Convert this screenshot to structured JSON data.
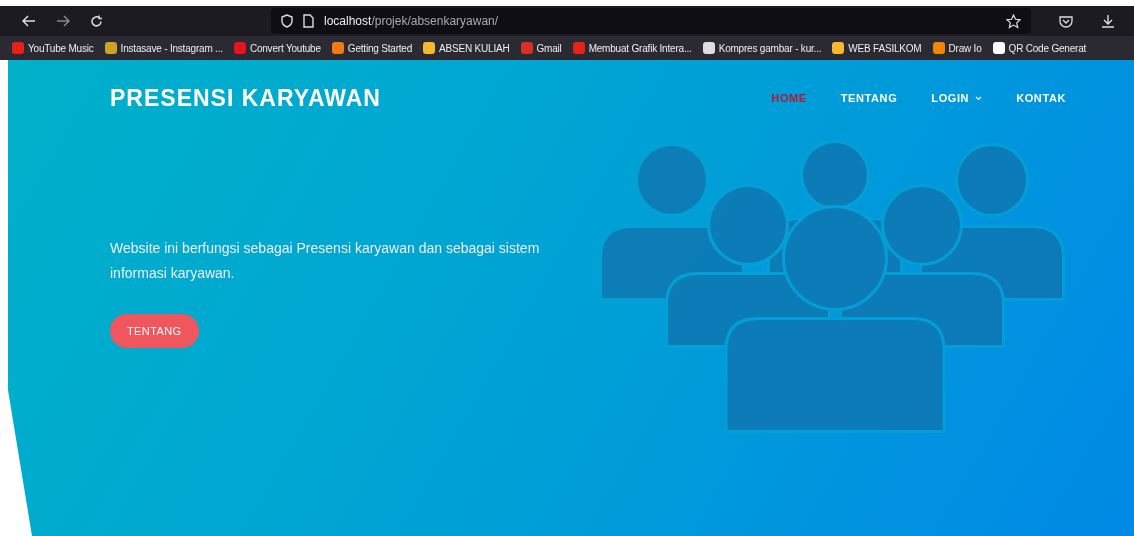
{
  "browser": {
    "url_host": "localhost",
    "url_path": "/projek/absenkaryawan/",
    "bookmarks": [
      {
        "label": "YouTube Music",
        "color": "#e62117"
      },
      {
        "label": "Instasave - Instagram ...",
        "color": "#c9a227"
      },
      {
        "label": "Convert Youtube",
        "color": "#e3141c"
      },
      {
        "label": "Getting Started",
        "color": "#f07b14"
      },
      {
        "label": "ABSEN KULIAH",
        "color": "#f5b82e"
      },
      {
        "label": "Gmail",
        "color": "#d93025"
      },
      {
        "label": "Membuat Grafik Intera...",
        "color": "#e62117"
      },
      {
        "label": "Kompres gambar - kur...",
        "color": "#dddddd"
      },
      {
        "label": "WEB FASILKOM",
        "color": "#f5b82e"
      },
      {
        "label": "Draw Io",
        "color": "#f08705"
      },
      {
        "label": "QR Code Generat",
        "color": "#ffffff"
      }
    ]
  },
  "site": {
    "brand": "PRESENSI KARYAWAN",
    "nav": [
      {
        "label": "HOME",
        "selected": true
      },
      {
        "label": "TENTANG",
        "selected": false
      },
      {
        "label": "LOGIN",
        "selected": false,
        "dropdown": true
      },
      {
        "label": "KONTAK",
        "selected": false
      }
    ],
    "hero_text": "Website ini berfungsi sebagai Presensi karyawan dan sebagai sistem informasi karyawan.",
    "hero_button": "TENTANG"
  }
}
